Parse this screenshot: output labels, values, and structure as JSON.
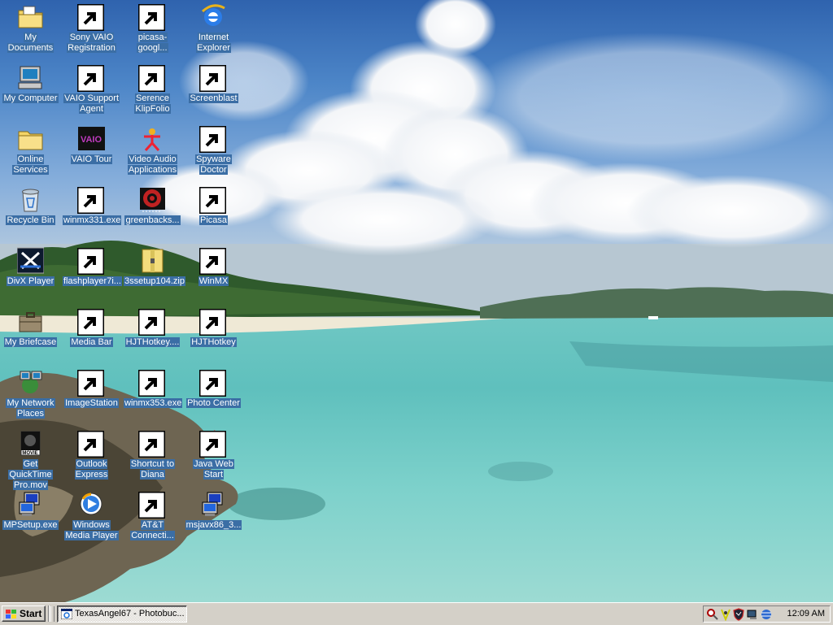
{
  "desktop": {
    "icons": [
      {
        "label": "My Documents",
        "icon": "folder-documents-icon",
        "shortcut": false
      },
      {
        "label": "Sony VAIO Registration",
        "icon": "registration-icon",
        "shortcut": true
      },
      {
        "label": "picasa-googl...",
        "icon": "installer-icon",
        "shortcut": true
      },
      {
        "label": "Internet Explorer",
        "icon": "internet-explorer-icon",
        "shortcut": false
      },
      {
        "label": "My Computer",
        "icon": "computer-icon",
        "shortcut": false
      },
      {
        "label": "VAIO Support Agent",
        "icon": "support-agent-icon",
        "shortcut": true
      },
      {
        "label": "Serence KlipFolio",
        "icon": "klipfolio-icon",
        "shortcut": true
      },
      {
        "label": "Screenblast",
        "icon": "screenblast-icon",
        "shortcut": true
      },
      {
        "label": "Online Services",
        "icon": "folder-icon",
        "shortcut": false
      },
      {
        "label": "VAIO Tour",
        "icon": "vaio-tour-icon",
        "shortcut": false
      },
      {
        "label": "Video Audio Applications",
        "icon": "video-audio-icon",
        "shortcut": false
      },
      {
        "label": "Spyware Doctor",
        "icon": "spyware-doctor-icon",
        "shortcut": true
      },
      {
        "label": "Recycle Bin",
        "icon": "recycle-bin-icon",
        "shortcut": false
      },
      {
        "label": "winmx331.exe",
        "icon": "installer-icon",
        "shortcut": true
      },
      {
        "label": "greenbacks...",
        "icon": "greenbacks-icon",
        "shortcut": false
      },
      {
        "label": "Picasa",
        "icon": "picasa-icon",
        "shortcut": true
      },
      {
        "label": "DivX Player",
        "icon": "divx-icon",
        "shortcut": false
      },
      {
        "label": "flashplayer7i...",
        "icon": "installer-icon",
        "shortcut": true
      },
      {
        "label": "3ssetup104.zip",
        "icon": "zip-icon",
        "shortcut": false
      },
      {
        "label": "WinMX",
        "icon": "winmx-icon",
        "shortcut": true
      },
      {
        "label": "My Briefcase",
        "icon": "briefcase-icon",
        "shortcut": false
      },
      {
        "label": "Media Bar",
        "icon": "media-bar-icon",
        "shortcut": true
      },
      {
        "label": "HJTHotkey....",
        "icon": "installer-icon",
        "shortcut": true
      },
      {
        "label": "HJTHotkey",
        "icon": "hjthotkey-icon",
        "shortcut": true
      },
      {
        "label": "My Network Places",
        "icon": "network-places-icon",
        "shortcut": false
      },
      {
        "label": "ImageStation",
        "icon": "imagestation-icon",
        "shortcut": true
      },
      {
        "label": "winmx353.exe",
        "icon": "installer-icon",
        "shortcut": true
      },
      {
        "label": "Photo Center",
        "icon": "photo-center-icon",
        "shortcut": true
      },
      {
        "label": "Get QuickTime Pro.mov",
        "icon": "quicktime-movie-icon",
        "shortcut": false
      },
      {
        "label": "Outlook Express",
        "icon": "outlook-express-icon",
        "shortcut": true
      },
      {
        "label": "Shortcut to Diana",
        "icon": "folder-icon",
        "shortcut": true
      },
      {
        "label": "Java Web Start",
        "icon": "java-icon",
        "shortcut": true
      },
      {
        "label": "MPSetup.exe",
        "icon": "installer-icon",
        "shortcut": false
      },
      {
        "label": "Windows Media Player",
        "icon": "media-player-icon",
        "shortcut": false
      },
      {
        "label": "AT&T Connecti...",
        "icon": "att-globe-icon",
        "shortcut": true
      },
      {
        "label": "msjavx86_3...",
        "icon": "installer-icon",
        "shortcut": false
      }
    ]
  },
  "taskbar": {
    "start_label": "Start",
    "task_label": "TexasAngel67 - Photobuc...",
    "tray_icons": [
      "search-tray-icon",
      "network-tray-icon",
      "shield-tray-icon",
      "monitor-tray-icon",
      "globe-tray-icon"
    ],
    "clock": "12:09 AM"
  },
  "colors": {
    "selection": "#3b6ea5",
    "taskbar": "#d4d0c8"
  }
}
